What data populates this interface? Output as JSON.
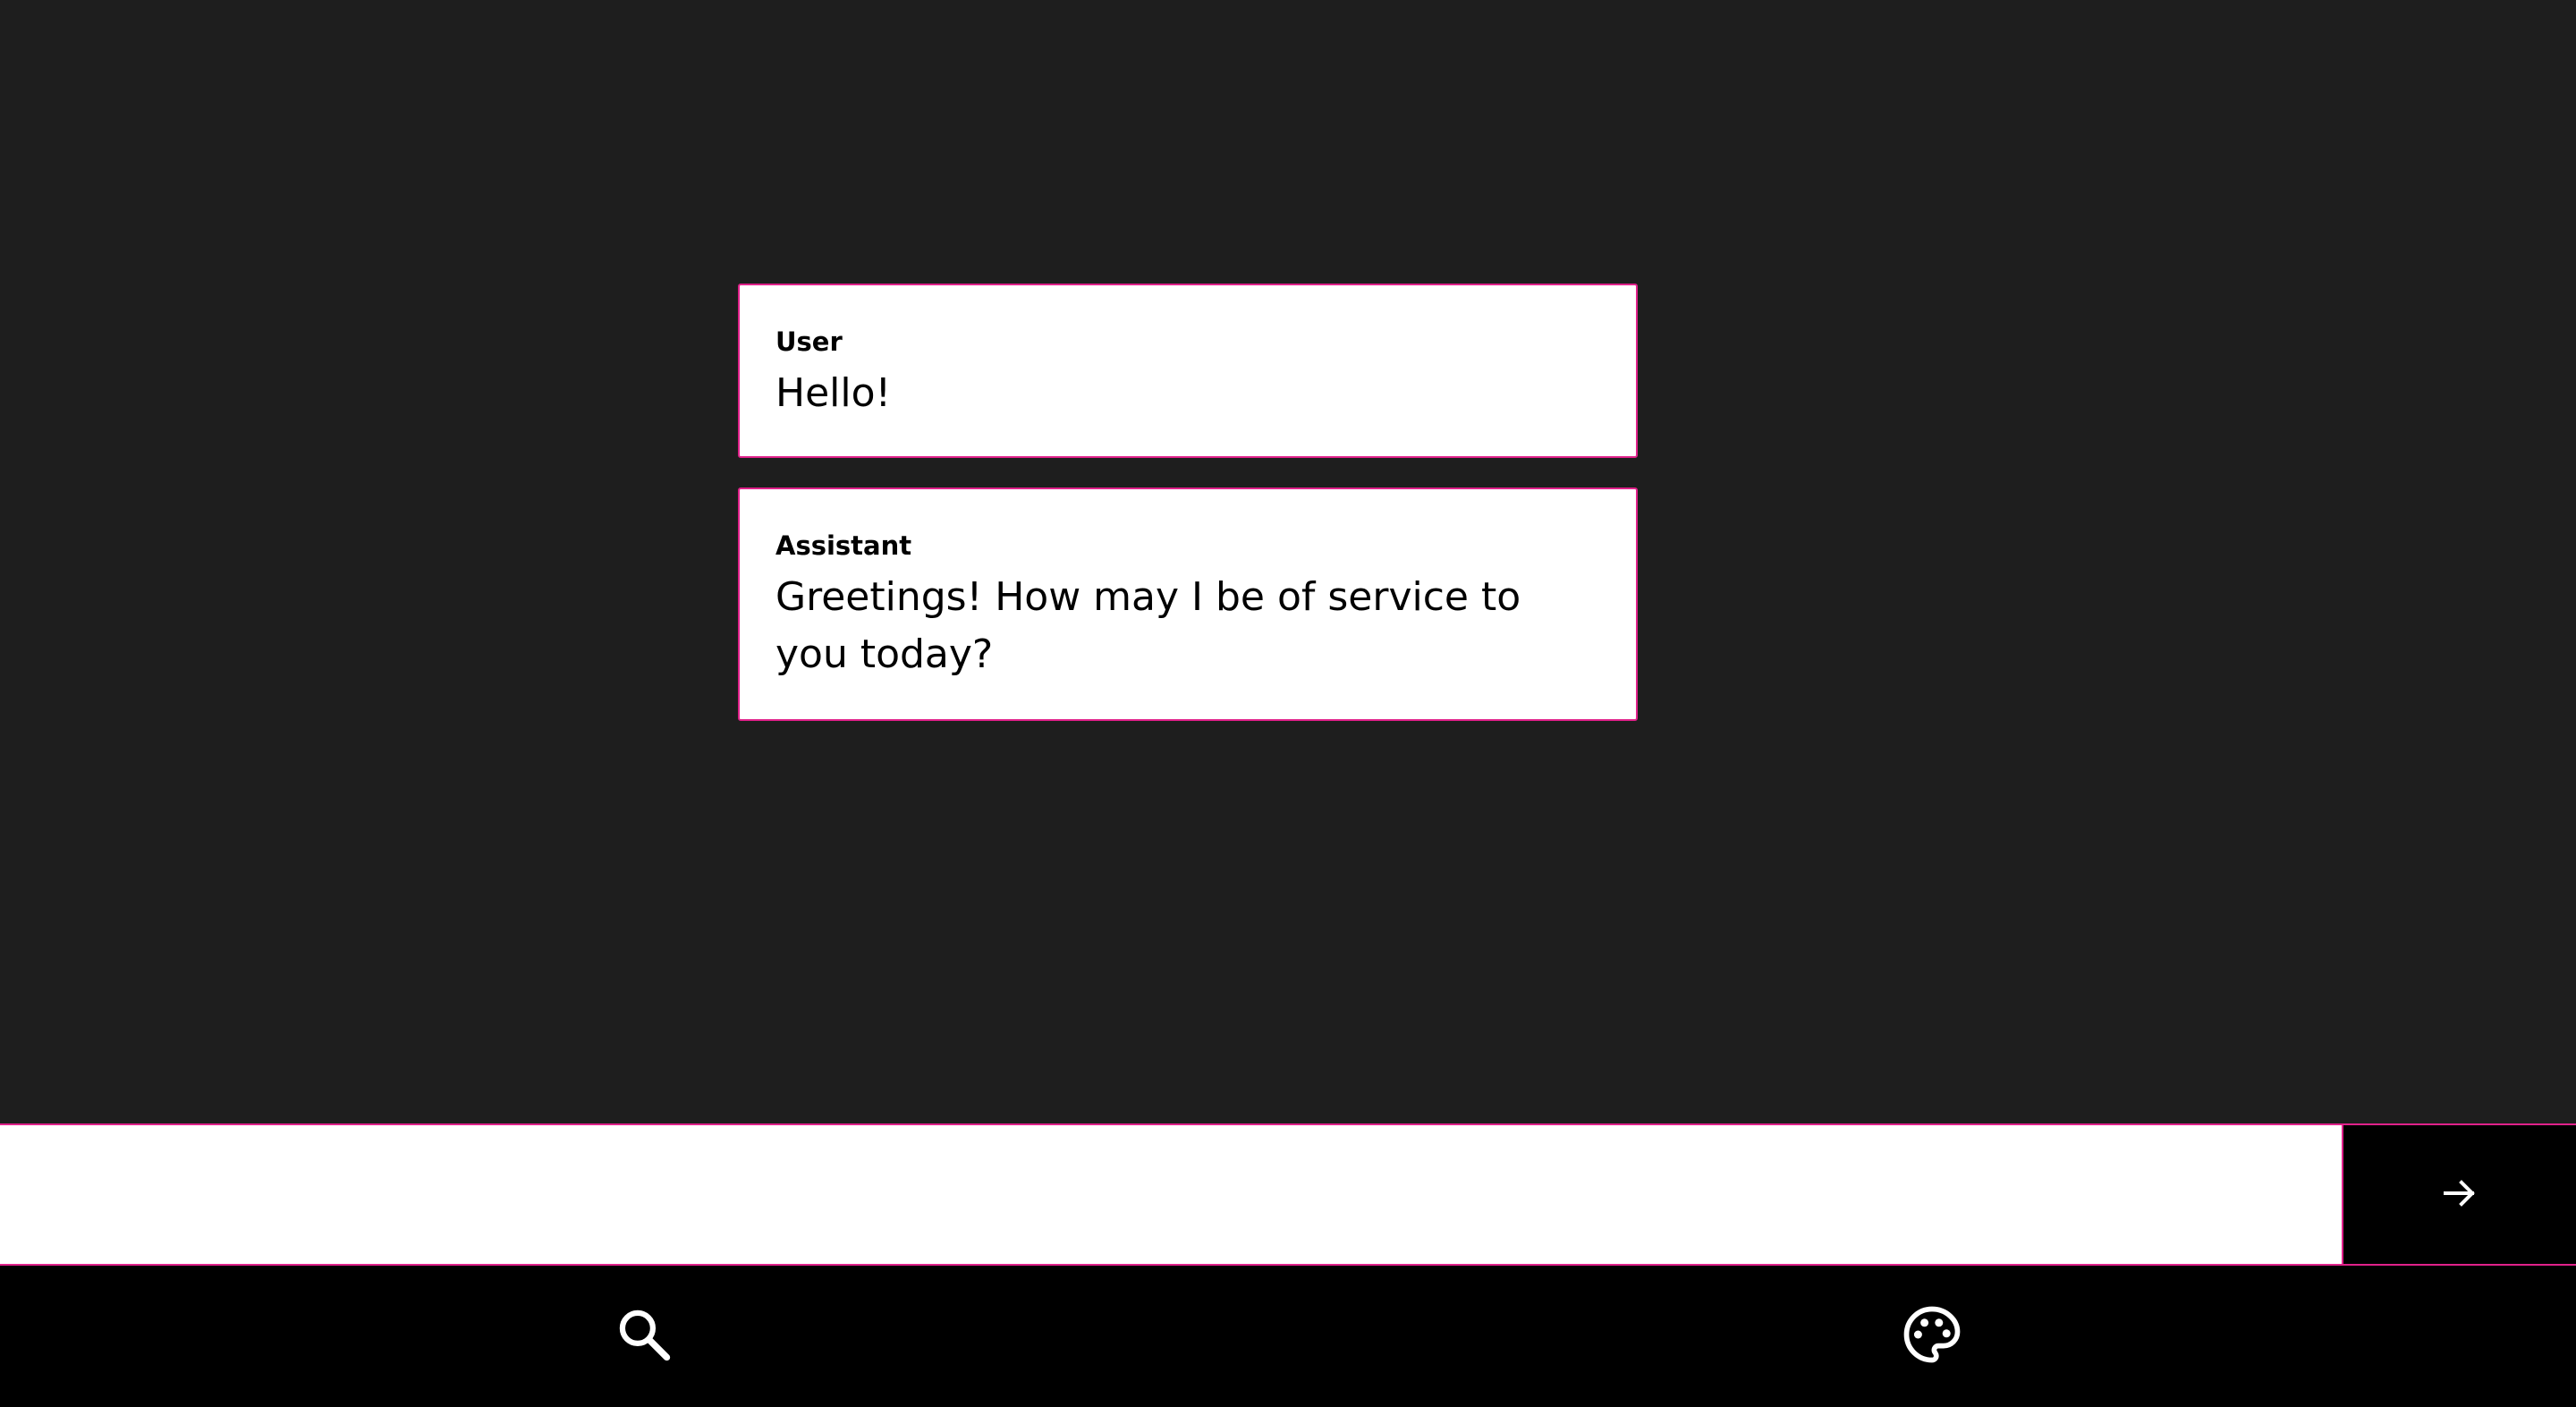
{
  "messages": [
    {
      "role": "User",
      "text": "Hello!"
    },
    {
      "role": "Assistant",
      "text": "Greetings! How may I be of service to you today?"
    }
  ],
  "input": {
    "value": "",
    "placeholder": ""
  },
  "send_button": {
    "icon": "arrow-right-icon"
  },
  "bottom_nav": {
    "items": [
      {
        "icon": "search-icon"
      },
      {
        "icon": "palette-icon"
      }
    ]
  },
  "colors": {
    "background": "#1e1e1e",
    "card": "#ffffff",
    "accent_border": "#e0218a",
    "bar": "#000000",
    "icon": "#ffffff"
  }
}
